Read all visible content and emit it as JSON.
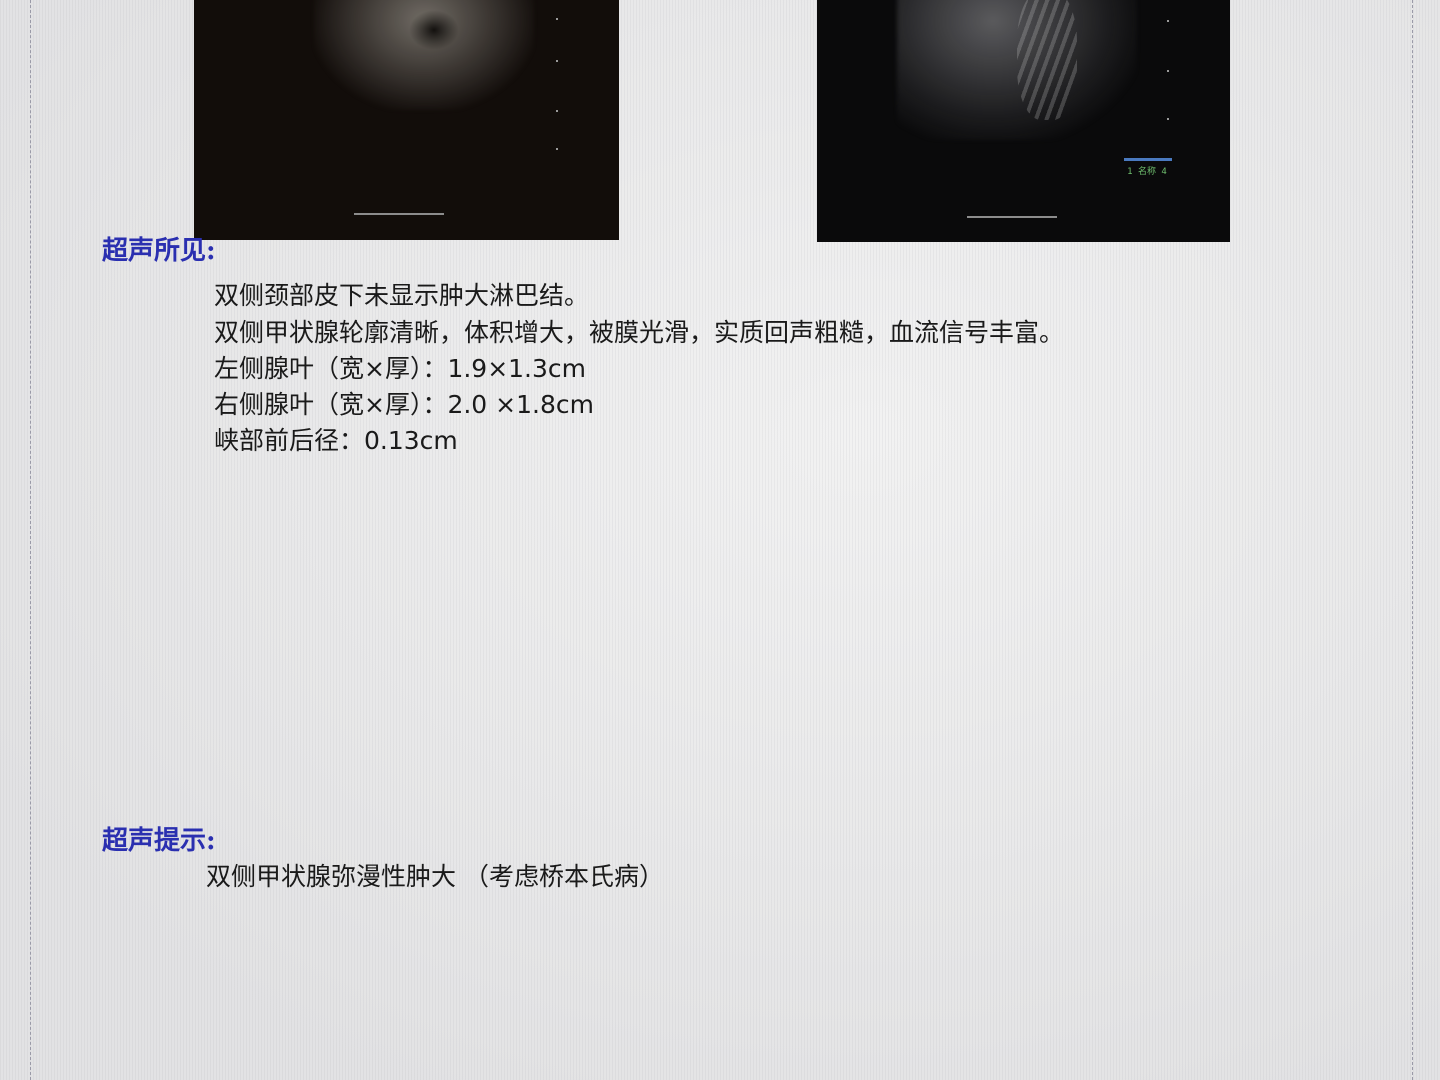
{
  "findings": {
    "title": "超声所见:",
    "lines": [
      "双侧颈部皮下未显示肿大淋巴结。",
      "双侧甲状腺轮廓清晰，体积增大，被膜光滑，实质回声粗糙，血流信号丰富。",
      "左侧腺叶（宽×厚）：1.9×1.3cm",
      "右侧腺叶（宽×厚）：2.0 ×1.8cm",
      "峡部前后径：0.13cm"
    ]
  },
  "impression": {
    "title": "超声提示:",
    "text": "双侧甲状腺弥漫性肿大 （考虑桥本氏病）"
  },
  "images": {
    "right_annotation": "1 名称 4"
  }
}
